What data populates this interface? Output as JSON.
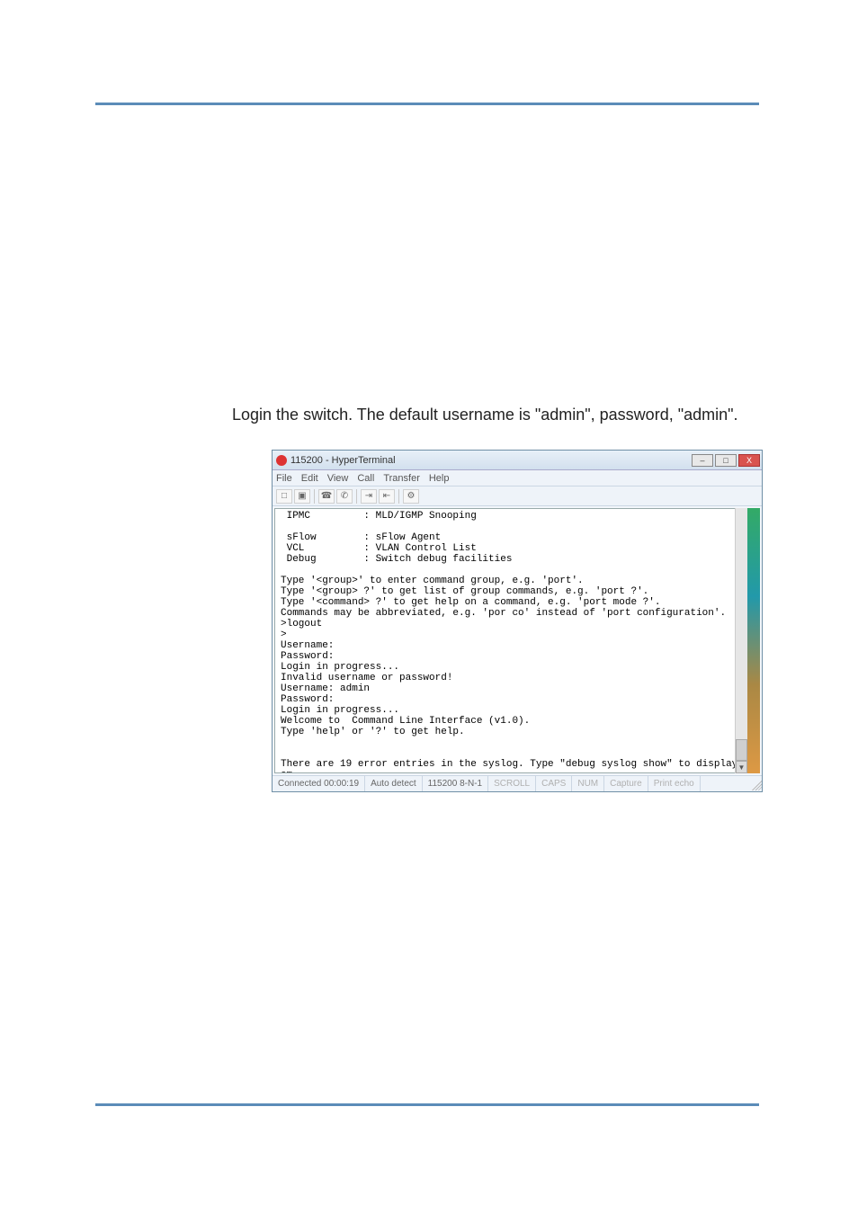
{
  "instruction": "Login the switch. The default username is \"admin\", password, \"admin\".",
  "window": {
    "title": "115200 - HyperTerminal",
    "buttons": {
      "min": "–",
      "max": "□",
      "close": "X"
    }
  },
  "menu": [
    "File",
    "Edit",
    "View",
    "Call",
    "Transfer",
    "Help"
  ],
  "toolbar_icons": [
    "new-file-icon",
    "open-file-icon",
    "sep",
    "call-icon",
    "hangup-icon",
    "sep",
    "send-icon",
    "receive-icon",
    "sep",
    "properties-icon"
  ],
  "terminal": " IPMC         : MLD/IGMP Snooping\n\n sFlow        : sFlow Agent\n VCL          : VLAN Control List\n Debug        : Switch debug facilities\n\nType '<group>' to enter command group, e.g. 'port'.\nType '<group> ?' to get list of group commands, e.g. 'port ?'.\nType '<command> ?' to get help on a command, e.g. 'port mode ?'.\nCommands may be abbreviated, e.g. 'por co' instead of 'port configuration'.\n>logout\n>\nUsername:\nPassword:\nLogin in progress...\nInvalid username or password!\nUsername: admin\nPassword:\nLogin in progress...\nWelcome to  Command Line Interface (v1.0).\nType 'help' or '?' to get help.\n\n\nThere are 19 error entries in the syslog. Type \"debug syslog show\" to display th\nem.\n>_",
  "status": {
    "time": "Connected 00:00:19",
    "detect": "Auto detect",
    "params": "115200 8-N-1",
    "scroll": "SCROLL",
    "caps": "CAPS",
    "num": "NUM",
    "capture": "Capture",
    "echo": "Print echo"
  }
}
